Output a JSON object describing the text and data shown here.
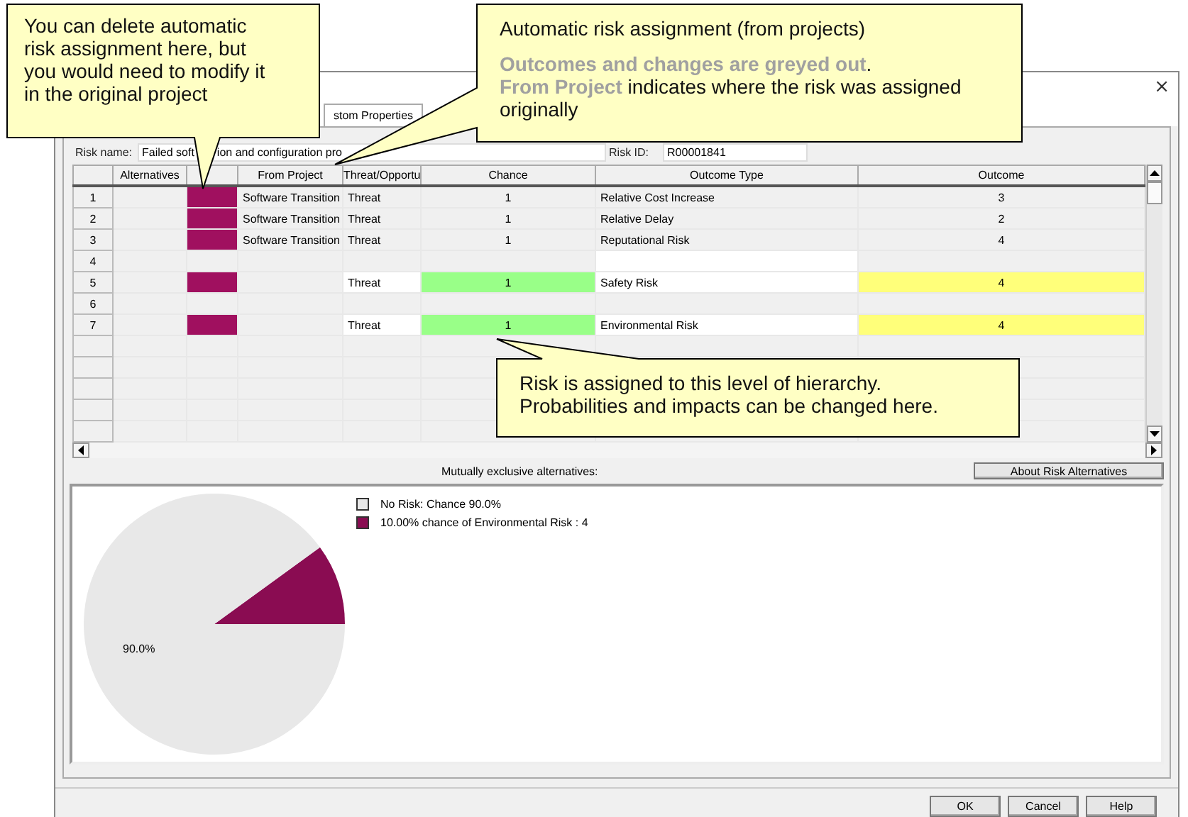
{
  "window": {
    "close": "×"
  },
  "tabs": [
    {
      "label": "stom Properties",
      "selected": true
    }
  ],
  "risk_name": {
    "label": "Risk name:",
    "value_parts": [
      "Failed soft",
      "ion and configuration pro"
    ]
  },
  "risk_id": {
    "label": "Risk ID:",
    "value": "R00001841"
  },
  "table": {
    "columns": [
      "",
      "Alternatives",
      "",
      "From Project",
      "Threat/Opportu",
      "Chance",
      "Outcome Type",
      "Outcome"
    ],
    "rows": [
      {
        "kind": "inherited",
        "number": "1",
        "color": "#a0105f",
        "from_project": "Software Transition",
        "threat": "Threat",
        "chance": "1",
        "outcome_type": "Relative Cost Increase",
        "outcome": "3"
      },
      {
        "kind": "inherited",
        "number": "2",
        "color": "#a0105f",
        "from_project": "Software Transition",
        "threat": "Threat",
        "chance": "1",
        "outcome_type": "Relative Delay",
        "outcome": "2"
      },
      {
        "kind": "inherited",
        "number": "3",
        "color": "#a0105f",
        "from_project": "Software Transition",
        "threat": "Threat",
        "chance": "1",
        "outcome_type": "Reputational Risk",
        "outcome": "4"
      },
      {
        "kind": "empty",
        "number": "4"
      },
      {
        "kind": "local",
        "number": "5",
        "color": "#a0105f",
        "threat": "Threat",
        "chance": "1",
        "outcome_type": "Safety Risk",
        "outcome": "4"
      },
      {
        "kind": "empty",
        "number": "6"
      },
      {
        "kind": "local",
        "number": "7",
        "color": "#a0105f",
        "threat": "Threat",
        "chance": "1",
        "outcome_type": "Environmental Risk",
        "outcome": "4"
      }
    ]
  },
  "alternatives": {
    "caption": "Mutually exclusive alternatives:",
    "button": "About Risk Alternatives",
    "slice_label": "90.0%",
    "chart_data": {
      "type": "pie",
      "categories": [
        "No Risk: Chance 90.0%",
        "10.00% chance of Environmental Risk : 4"
      ],
      "values": [
        90,
        10
      ],
      "colors": [
        "#e8e8e8",
        "#8a0c52"
      ]
    }
  },
  "buttons": [
    "OK",
    "Cancel",
    "Help"
  ],
  "callouts": [
    {
      "lines": [
        "You can delete automatic risk assignment here, but you would need to modify it in the original project"
      ]
    },
    {
      "lines": [
        "Automatic risk assignment (from projects)",
        "**Outcomes and changes are greyed out**.",
        "**From Project** indicates where the risk was assigned originally"
      ]
    },
    {
      "lines": [
        "Risk is assigned to this level of hierarchy.",
        "Probabilities and impacts can be changed here."
      ]
    }
  ]
}
